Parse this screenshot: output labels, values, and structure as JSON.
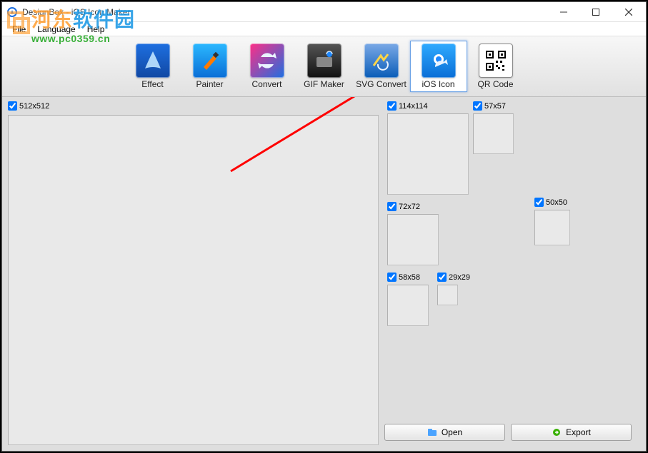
{
  "window": {
    "title": "DesignBox - iOS Icon Maker"
  },
  "menu": {
    "file": "File",
    "language": "Language",
    "help": "Help"
  },
  "toolbar": {
    "effect": "Effect",
    "painter": "Painter",
    "convert": "Convert",
    "gif_maker": "GIF Maker",
    "svg_convert": "SVG Convert",
    "ios_icon": "iOS Icon",
    "qr_code": "QR Code"
  },
  "sizes": {
    "s512": "512x512",
    "s114": "114x114",
    "s72": "72x72",
    "s58": "58x58",
    "s57": "57x57",
    "s50": "50x50",
    "s29": "29x29"
  },
  "buttons": {
    "open": "Open",
    "export": "Export"
  },
  "watermark": {
    "cn_1": "河东",
    "cn_2": "软件园",
    "url": "www.pc0359.cn"
  },
  "icon_colors": {
    "effect": [
      "#1e6fe0",
      "#1148a3"
    ],
    "painter": [
      "#2bb8ff",
      "#0a6ed6"
    ],
    "convert": [
      "#84c3ff",
      "#0a6ed6"
    ],
    "gif": [
      "#444",
      "#111"
    ],
    "svg": [
      "#7aa9e6",
      "#0a5db8"
    ],
    "ios": [
      "#2faaff",
      "#0a6ed6"
    ],
    "qr": [
      "#fff",
      "#000"
    ]
  }
}
